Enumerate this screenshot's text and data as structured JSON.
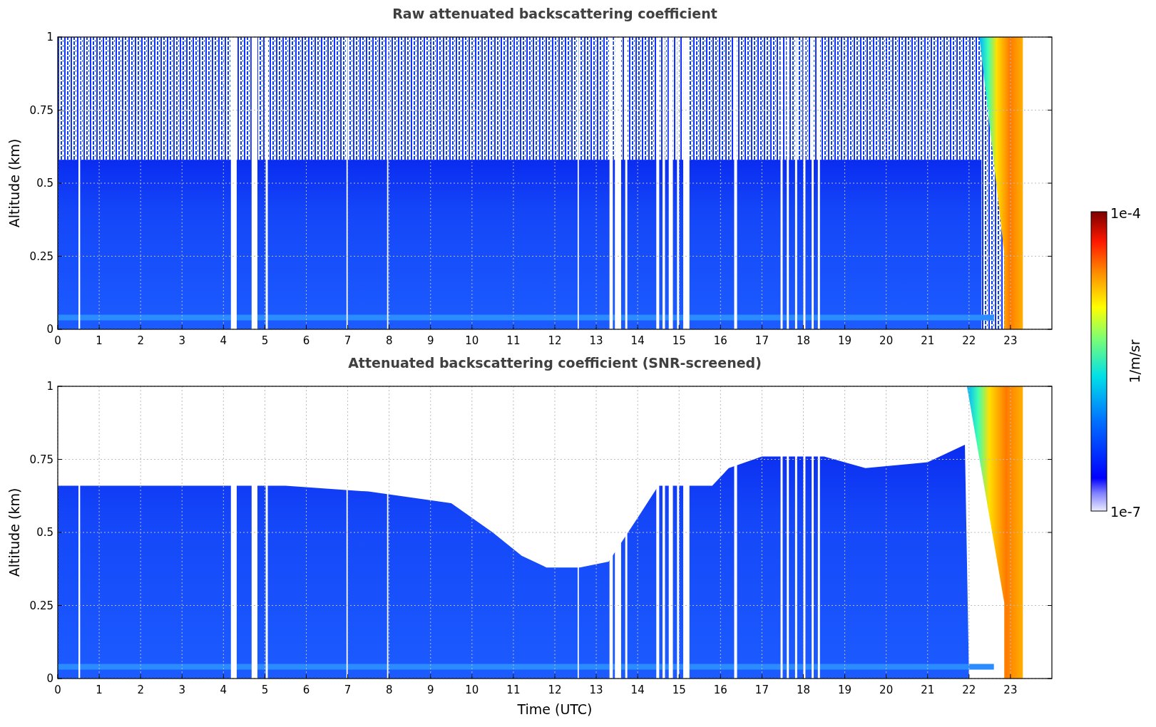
{
  "panels": [
    {
      "kind": "raw",
      "title": "Raw attenuated backscattering coefficient",
      "ylabel": "Altitude (km)",
      "yticks": [
        "1",
        "0.75",
        "0.5",
        "0.25",
        "0"
      ],
      "xticks": [
        "0",
        "1",
        "2",
        "3",
        "4",
        "5",
        "6",
        "7",
        "8",
        "9",
        "10",
        "11",
        "12",
        "13",
        "14",
        "15",
        "16",
        "17",
        "18",
        "19",
        "20",
        "21",
        "22",
        "23"
      ]
    },
    {
      "kind": "screened",
      "title": "Attenuated backscattering coefficient (SNR-screened)",
      "ylabel": "Altitude (km)",
      "xlabel": "Time (UTC)",
      "yticks": [
        "1",
        "0.75",
        "0.5",
        "0.25",
        "0"
      ],
      "xticks": [
        "0",
        "1",
        "2",
        "3",
        "4",
        "5",
        "6",
        "7",
        "8",
        "9",
        "10",
        "11",
        "12",
        "13",
        "14",
        "15",
        "16",
        "17",
        "18",
        "19",
        "20",
        "21",
        "22",
        "23"
      ]
    }
  ],
  "colorbar": {
    "max_label": "1e-4",
    "min_label": "1e-7",
    "unit": "1/m/sr"
  }
}
